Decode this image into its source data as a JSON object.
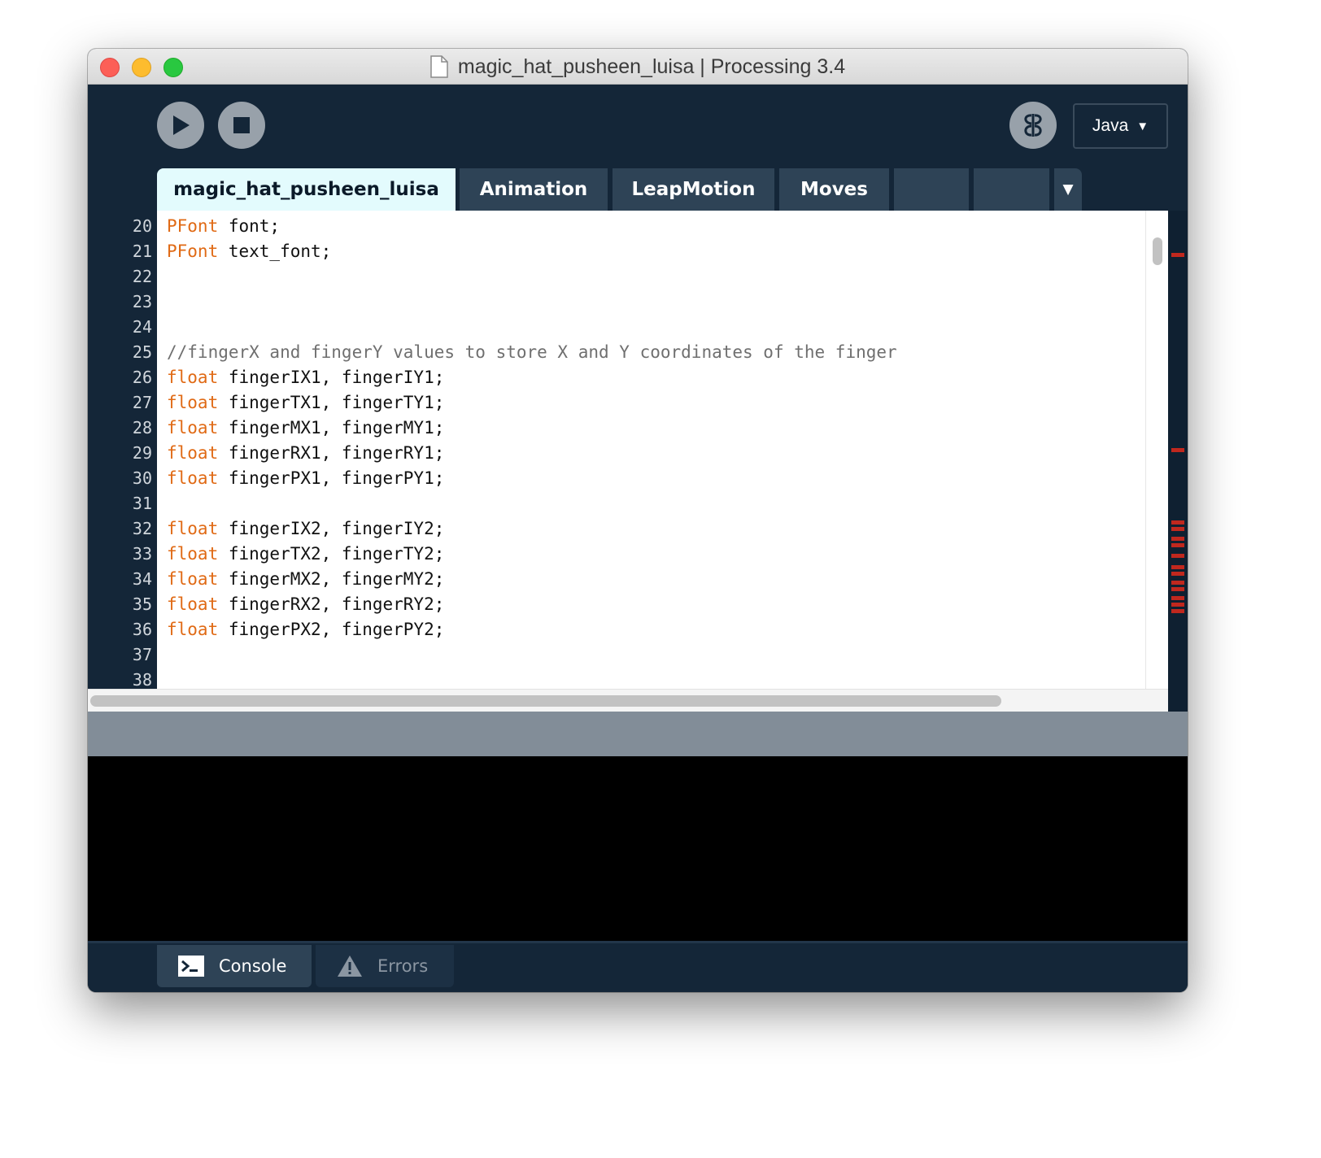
{
  "window": {
    "title": "magic_hat_pusheen_luisa | Processing 3.4"
  },
  "toolbar": {
    "run_icon": "play-icon",
    "stop_icon": "stop-icon",
    "debug_icon": "butterfly-debugger-icon",
    "mode_label": "Java",
    "mode_arrow": "▼"
  },
  "tabs": {
    "items": [
      "magic_hat_pusheen_luisa",
      "Animation",
      "LeapMotion",
      "Moves",
      "",
      ""
    ],
    "active_index": 0,
    "overflow_arrow": "▼"
  },
  "editor": {
    "line_numbers": [
      "20",
      "21",
      "22",
      "23",
      "24",
      "25",
      "26",
      "27",
      "28",
      "29",
      "30",
      "31",
      "32",
      "33",
      "34",
      "35",
      "36",
      "37",
      "38"
    ],
    "lines": [
      {
        "kw": "PFont",
        "rest": " font;"
      },
      {
        "kw": "PFont",
        "rest": " text_font;"
      },
      {
        "kw": "",
        "rest": ""
      },
      {
        "kw": "",
        "rest": ""
      },
      {
        "kw": "",
        "rest": ""
      },
      {
        "comment": "//fingerX and fingerY values to store X and Y coordinates of the finger"
      },
      {
        "kw": "float",
        "rest": " fingerIX1, fingerIY1;"
      },
      {
        "kw": "float",
        "rest": " fingerTX1, fingerTY1;"
      },
      {
        "kw": "float",
        "rest": " fingerMX1, fingerMY1;"
      },
      {
        "kw": "float",
        "rest": " fingerRX1, fingerRY1;"
      },
      {
        "kw": "float",
        "rest": " fingerPX1, fingerPY1;"
      },
      {
        "kw": "",
        "rest": ""
      },
      {
        "kw": "float",
        "rest": " fingerIX2, fingerIY2;"
      },
      {
        "kw": "float",
        "rest": " fingerTX2, fingerTY2;"
      },
      {
        "kw": "float",
        "rest": " fingerMX2, fingerMY2;"
      },
      {
        "kw": "float",
        "rest": " fingerRX2, fingerRY2;"
      },
      {
        "kw": "float",
        "rest": " fingerPX2, fingerPY2;"
      },
      {
        "kw": "",
        "rest": ""
      },
      {
        "kw": "",
        "rest": ""
      }
    ]
  },
  "footer": {
    "console_label": "Console",
    "errors_label": "Errors"
  },
  "colors": {
    "keyword": "#e06a15",
    "comment": "#6f6f6f",
    "background": "#142638",
    "active_tab": "#e3fbfd",
    "error_marker": "#c0281e"
  }
}
